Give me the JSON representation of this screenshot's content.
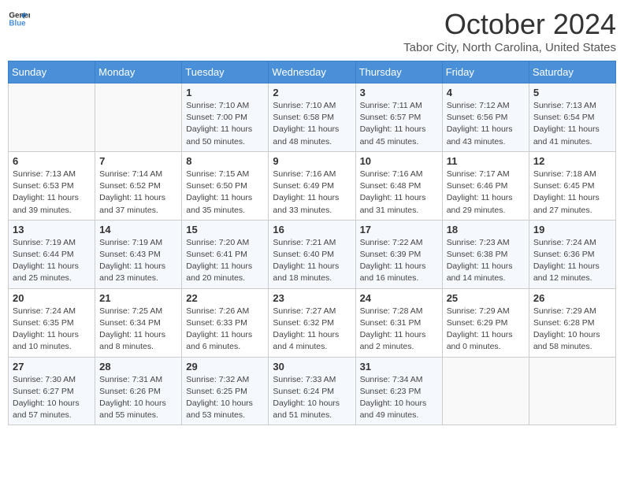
{
  "header": {
    "logo_line1": "General",
    "logo_line2": "Blue",
    "month": "October 2024",
    "location": "Tabor City, North Carolina, United States"
  },
  "days_of_week": [
    "Sunday",
    "Monday",
    "Tuesday",
    "Wednesday",
    "Thursday",
    "Friday",
    "Saturday"
  ],
  "weeks": [
    [
      {
        "day": "",
        "info": ""
      },
      {
        "day": "",
        "info": ""
      },
      {
        "day": "1",
        "info": "Sunrise: 7:10 AM\nSunset: 7:00 PM\nDaylight: 11 hours and 50 minutes."
      },
      {
        "day": "2",
        "info": "Sunrise: 7:10 AM\nSunset: 6:58 PM\nDaylight: 11 hours and 48 minutes."
      },
      {
        "day": "3",
        "info": "Sunrise: 7:11 AM\nSunset: 6:57 PM\nDaylight: 11 hours and 45 minutes."
      },
      {
        "day": "4",
        "info": "Sunrise: 7:12 AM\nSunset: 6:56 PM\nDaylight: 11 hours and 43 minutes."
      },
      {
        "day": "5",
        "info": "Sunrise: 7:13 AM\nSunset: 6:54 PM\nDaylight: 11 hours and 41 minutes."
      }
    ],
    [
      {
        "day": "6",
        "info": "Sunrise: 7:13 AM\nSunset: 6:53 PM\nDaylight: 11 hours and 39 minutes."
      },
      {
        "day": "7",
        "info": "Sunrise: 7:14 AM\nSunset: 6:52 PM\nDaylight: 11 hours and 37 minutes."
      },
      {
        "day": "8",
        "info": "Sunrise: 7:15 AM\nSunset: 6:50 PM\nDaylight: 11 hours and 35 minutes."
      },
      {
        "day": "9",
        "info": "Sunrise: 7:16 AM\nSunset: 6:49 PM\nDaylight: 11 hours and 33 minutes."
      },
      {
        "day": "10",
        "info": "Sunrise: 7:16 AM\nSunset: 6:48 PM\nDaylight: 11 hours and 31 minutes."
      },
      {
        "day": "11",
        "info": "Sunrise: 7:17 AM\nSunset: 6:46 PM\nDaylight: 11 hours and 29 minutes."
      },
      {
        "day": "12",
        "info": "Sunrise: 7:18 AM\nSunset: 6:45 PM\nDaylight: 11 hours and 27 minutes."
      }
    ],
    [
      {
        "day": "13",
        "info": "Sunrise: 7:19 AM\nSunset: 6:44 PM\nDaylight: 11 hours and 25 minutes."
      },
      {
        "day": "14",
        "info": "Sunrise: 7:19 AM\nSunset: 6:43 PM\nDaylight: 11 hours and 23 minutes."
      },
      {
        "day": "15",
        "info": "Sunrise: 7:20 AM\nSunset: 6:41 PM\nDaylight: 11 hours and 20 minutes."
      },
      {
        "day": "16",
        "info": "Sunrise: 7:21 AM\nSunset: 6:40 PM\nDaylight: 11 hours and 18 minutes."
      },
      {
        "day": "17",
        "info": "Sunrise: 7:22 AM\nSunset: 6:39 PM\nDaylight: 11 hours and 16 minutes."
      },
      {
        "day": "18",
        "info": "Sunrise: 7:23 AM\nSunset: 6:38 PM\nDaylight: 11 hours and 14 minutes."
      },
      {
        "day": "19",
        "info": "Sunrise: 7:24 AM\nSunset: 6:36 PM\nDaylight: 11 hours and 12 minutes."
      }
    ],
    [
      {
        "day": "20",
        "info": "Sunrise: 7:24 AM\nSunset: 6:35 PM\nDaylight: 11 hours and 10 minutes."
      },
      {
        "day": "21",
        "info": "Sunrise: 7:25 AM\nSunset: 6:34 PM\nDaylight: 11 hours and 8 minutes."
      },
      {
        "day": "22",
        "info": "Sunrise: 7:26 AM\nSunset: 6:33 PM\nDaylight: 11 hours and 6 minutes."
      },
      {
        "day": "23",
        "info": "Sunrise: 7:27 AM\nSunset: 6:32 PM\nDaylight: 11 hours and 4 minutes."
      },
      {
        "day": "24",
        "info": "Sunrise: 7:28 AM\nSunset: 6:31 PM\nDaylight: 11 hours and 2 minutes."
      },
      {
        "day": "25",
        "info": "Sunrise: 7:29 AM\nSunset: 6:29 PM\nDaylight: 11 hours and 0 minutes."
      },
      {
        "day": "26",
        "info": "Sunrise: 7:29 AM\nSunset: 6:28 PM\nDaylight: 10 hours and 58 minutes."
      }
    ],
    [
      {
        "day": "27",
        "info": "Sunrise: 7:30 AM\nSunset: 6:27 PM\nDaylight: 10 hours and 57 minutes."
      },
      {
        "day": "28",
        "info": "Sunrise: 7:31 AM\nSunset: 6:26 PM\nDaylight: 10 hours and 55 minutes."
      },
      {
        "day": "29",
        "info": "Sunrise: 7:32 AM\nSunset: 6:25 PM\nDaylight: 10 hours and 53 minutes."
      },
      {
        "day": "30",
        "info": "Sunrise: 7:33 AM\nSunset: 6:24 PM\nDaylight: 10 hours and 51 minutes."
      },
      {
        "day": "31",
        "info": "Sunrise: 7:34 AM\nSunset: 6:23 PM\nDaylight: 10 hours and 49 minutes."
      },
      {
        "day": "",
        "info": ""
      },
      {
        "day": "",
        "info": ""
      }
    ]
  ]
}
